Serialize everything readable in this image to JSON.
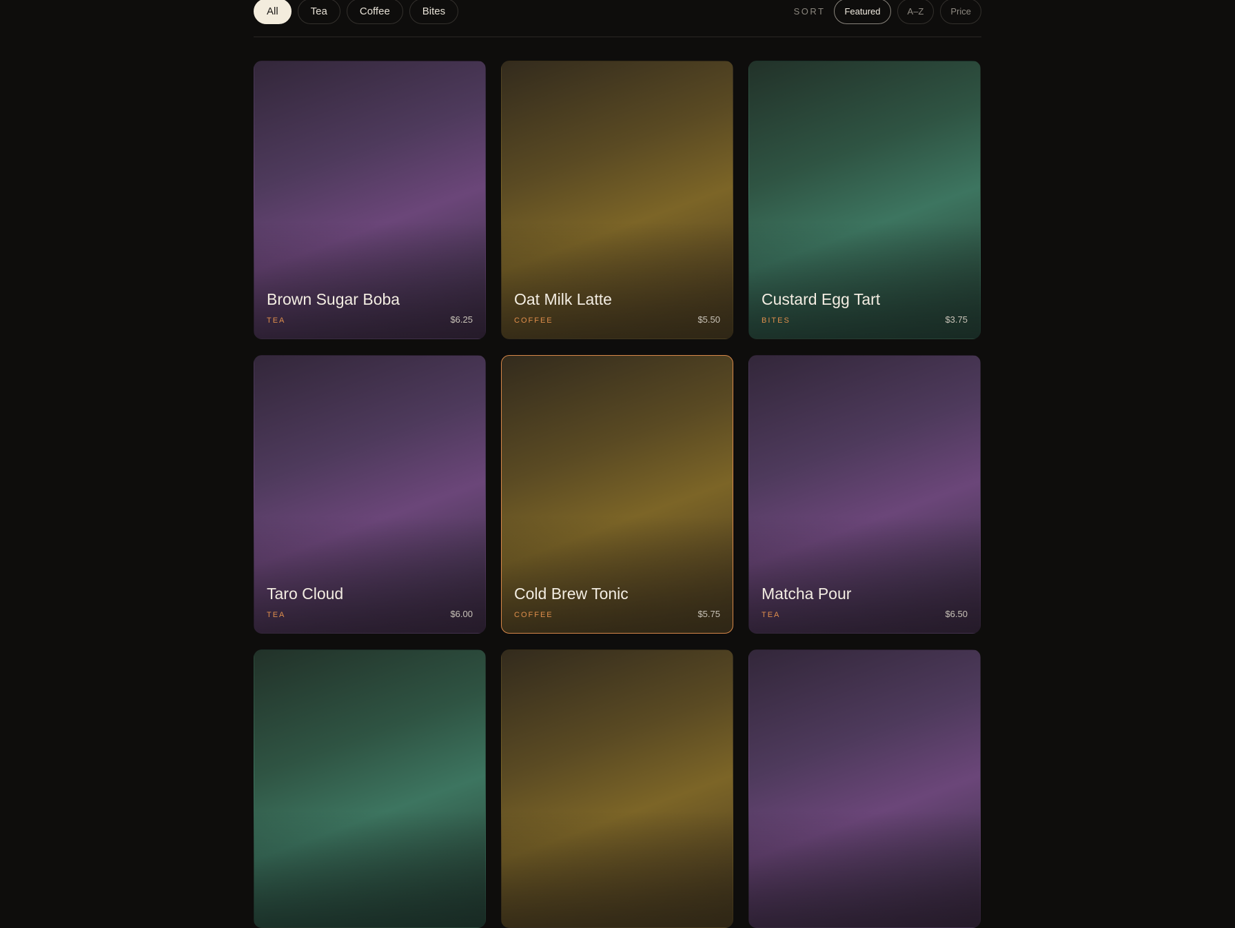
{
  "filters": [
    {
      "label": "All",
      "active": true
    },
    {
      "label": "Tea",
      "active": false
    },
    {
      "label": "Coffee",
      "active": false
    },
    {
      "label": "Bites",
      "active": false
    }
  ],
  "sort": {
    "label": "SORT",
    "options": [
      {
        "label": "Featured",
        "active": true
      },
      {
        "label": "A–Z",
        "active": false
      },
      {
        "label": "Price",
        "active": false
      }
    ]
  },
  "accent_color": "#d9894a",
  "products": [
    {
      "name": "Brown Sugar Boba",
      "category": "TEA",
      "price": "$6.25",
      "theme": "tea"
    },
    {
      "name": "Oat Milk Latte",
      "category": "COFFEE",
      "price": "$5.50",
      "theme": "coffee"
    },
    {
      "name": "Custard Egg Tart",
      "category": "BITES",
      "price": "$3.75",
      "theme": "bites"
    },
    {
      "name": "Taro Cloud",
      "category": "TEA",
      "price": "$6.00",
      "theme": "tea"
    },
    {
      "name": "Cold Brew Tonic",
      "category": "COFFEE",
      "price": "$5.75",
      "theme": "coffee",
      "selected": true
    },
    {
      "name": "Matcha Pour",
      "category": "TEA",
      "price": "$6.50",
      "theme": "tea"
    },
    {
      "name": "",
      "category": "",
      "price": "",
      "theme": "bites"
    },
    {
      "name": "",
      "category": "",
      "price": "",
      "theme": "coffee"
    },
    {
      "name": "",
      "category": "",
      "price": "",
      "theme": "tea"
    }
  ]
}
